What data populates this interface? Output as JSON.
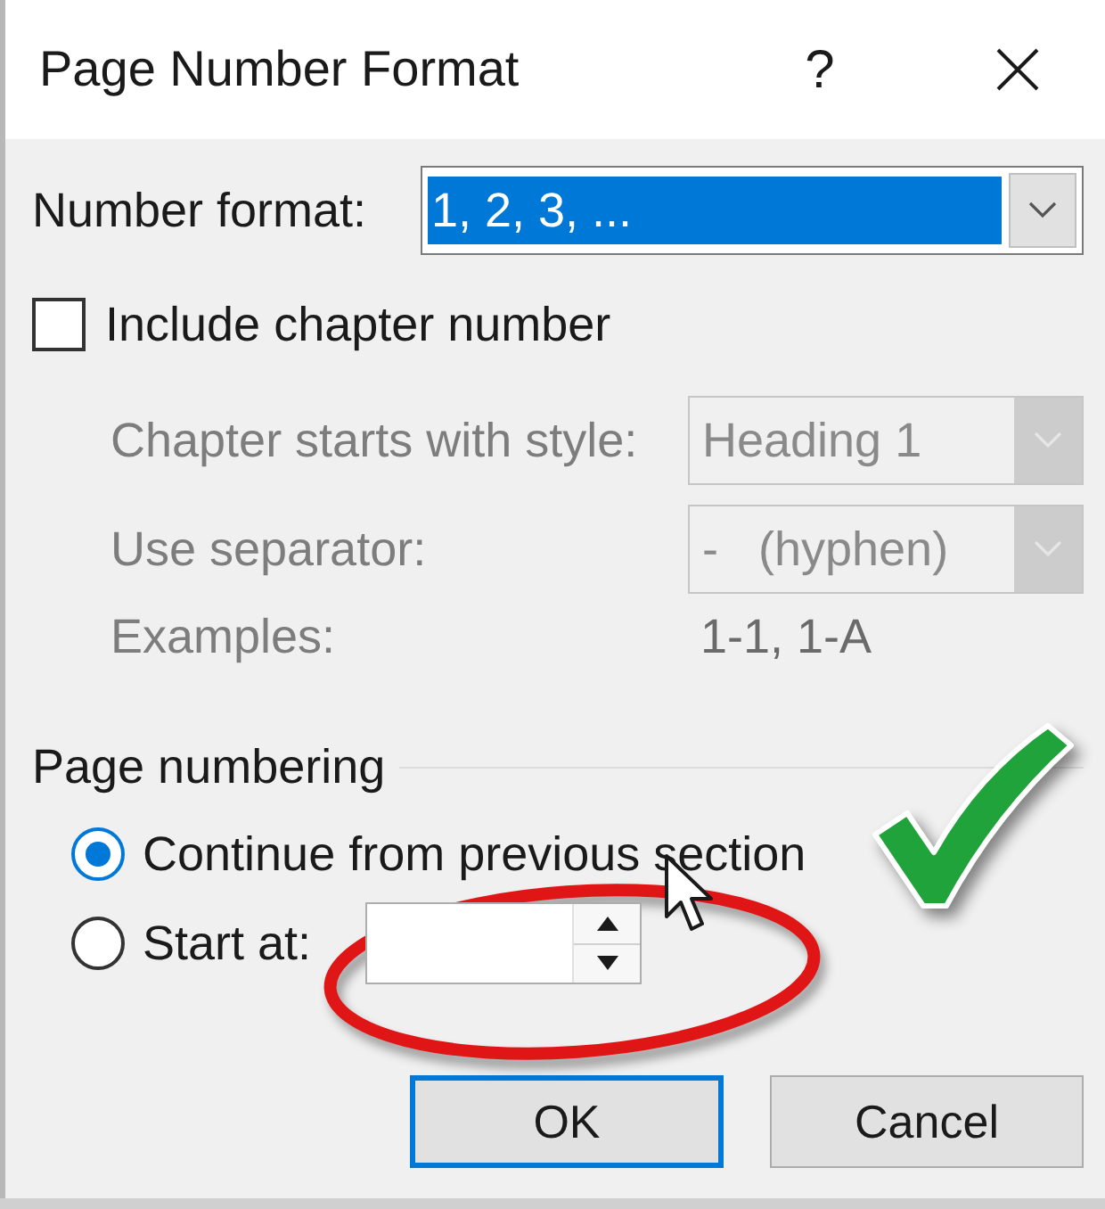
{
  "window": {
    "title": "Page Number Format",
    "help": "?"
  },
  "number_format": {
    "label": "Number format:",
    "value": "1, 2, 3, ...",
    "focused": true
  },
  "include_chapter_number": {
    "label": "Include chapter number",
    "checked": false
  },
  "chapter_fields": [
    {
      "kind": "dropdown",
      "label": "Chapter starts with style:",
      "value": "Heading 1",
      "disabled": true
    },
    {
      "kind": "dropdown",
      "label": "Use separator:",
      "value": "-   (hyphen)",
      "disabled": true
    },
    {
      "kind": "text",
      "label": "Examples:",
      "value": "1-1, 1-A",
      "disabled": true
    }
  ],
  "page_numbering": {
    "heading": "Page numbering",
    "options": [
      {
        "kind": "radio",
        "label": "Continue from previous section",
        "selected": true
      },
      {
        "kind": "spinner",
        "label": "Start at:",
        "selected": false
      }
    ]
  },
  "buttons": [
    {
      "label": "OK",
      "default": true
    },
    {
      "label": "Cancel",
      "default": false
    }
  ],
  "annotations": [
    {
      "kind": "ellipse"
    },
    {
      "kind": "pointer"
    },
    {
      "kind": "checkmark"
    }
  ]
}
